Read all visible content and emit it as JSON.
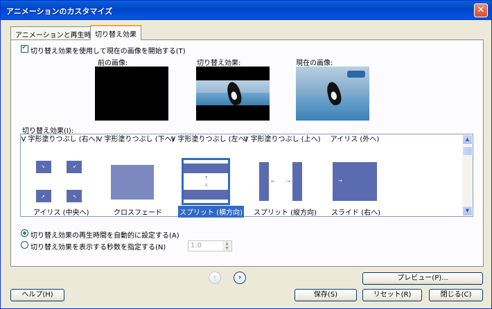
{
  "window": {
    "title": "アニメーションのカスタマイズ",
    "close_glyph": "✕"
  },
  "tabs": [
    {
      "label": "アニメーションと再生時間",
      "active": false
    },
    {
      "label": "切り替え効果",
      "active": true
    }
  ],
  "transition_checkbox": {
    "label": "切り替え効果を使用して現在の画像を開始する(T)",
    "checked": true
  },
  "previews": {
    "previous_label": "前の画像:",
    "transition_label": "切り替え効果:",
    "current_label": "現在の画像:"
  },
  "effects_list": {
    "label": "切り替え効果(I):",
    "top_row": [
      "V 字形塗りつぶし (右へ)",
      "V 字形塗りつぶし (下へ)",
      "V 字形塗りつぶし (左へ)",
      "V 字形塗りつぶし (上へ)",
      "アイリス (外へ)"
    ],
    "items": [
      {
        "label": "アイリス (中央へ)",
        "selected": false
      },
      {
        "label": "クロスフェード",
        "selected": false
      },
      {
        "label": "スプリット (横方向)",
        "selected": true
      },
      {
        "label": "スプリット (縦方向)",
        "selected": false
      },
      {
        "label": "スライド (右へ)",
        "selected": false
      }
    ]
  },
  "duration": {
    "auto_label": "切り替え効果の再生時間を自動的に設定する(A)",
    "manual_label": "切り替え効果を表示する秒数を指定する(N)",
    "selected": "auto",
    "seconds_value": "1.0"
  },
  "nav": {
    "back_glyph": "‹",
    "forward_glyph": "›"
  },
  "buttons": {
    "preview": "プレビュー(P)...",
    "help": "ヘルプ(H)",
    "save": "保存(S)",
    "reset": "リセット(R)",
    "close": "閉じる(C)"
  },
  "colors": {
    "titlebar": "#0a5fd8",
    "selection": "#316ac5",
    "thumb_blue": "#5b6bb0",
    "tab_highlight": "#f0a43a"
  }
}
